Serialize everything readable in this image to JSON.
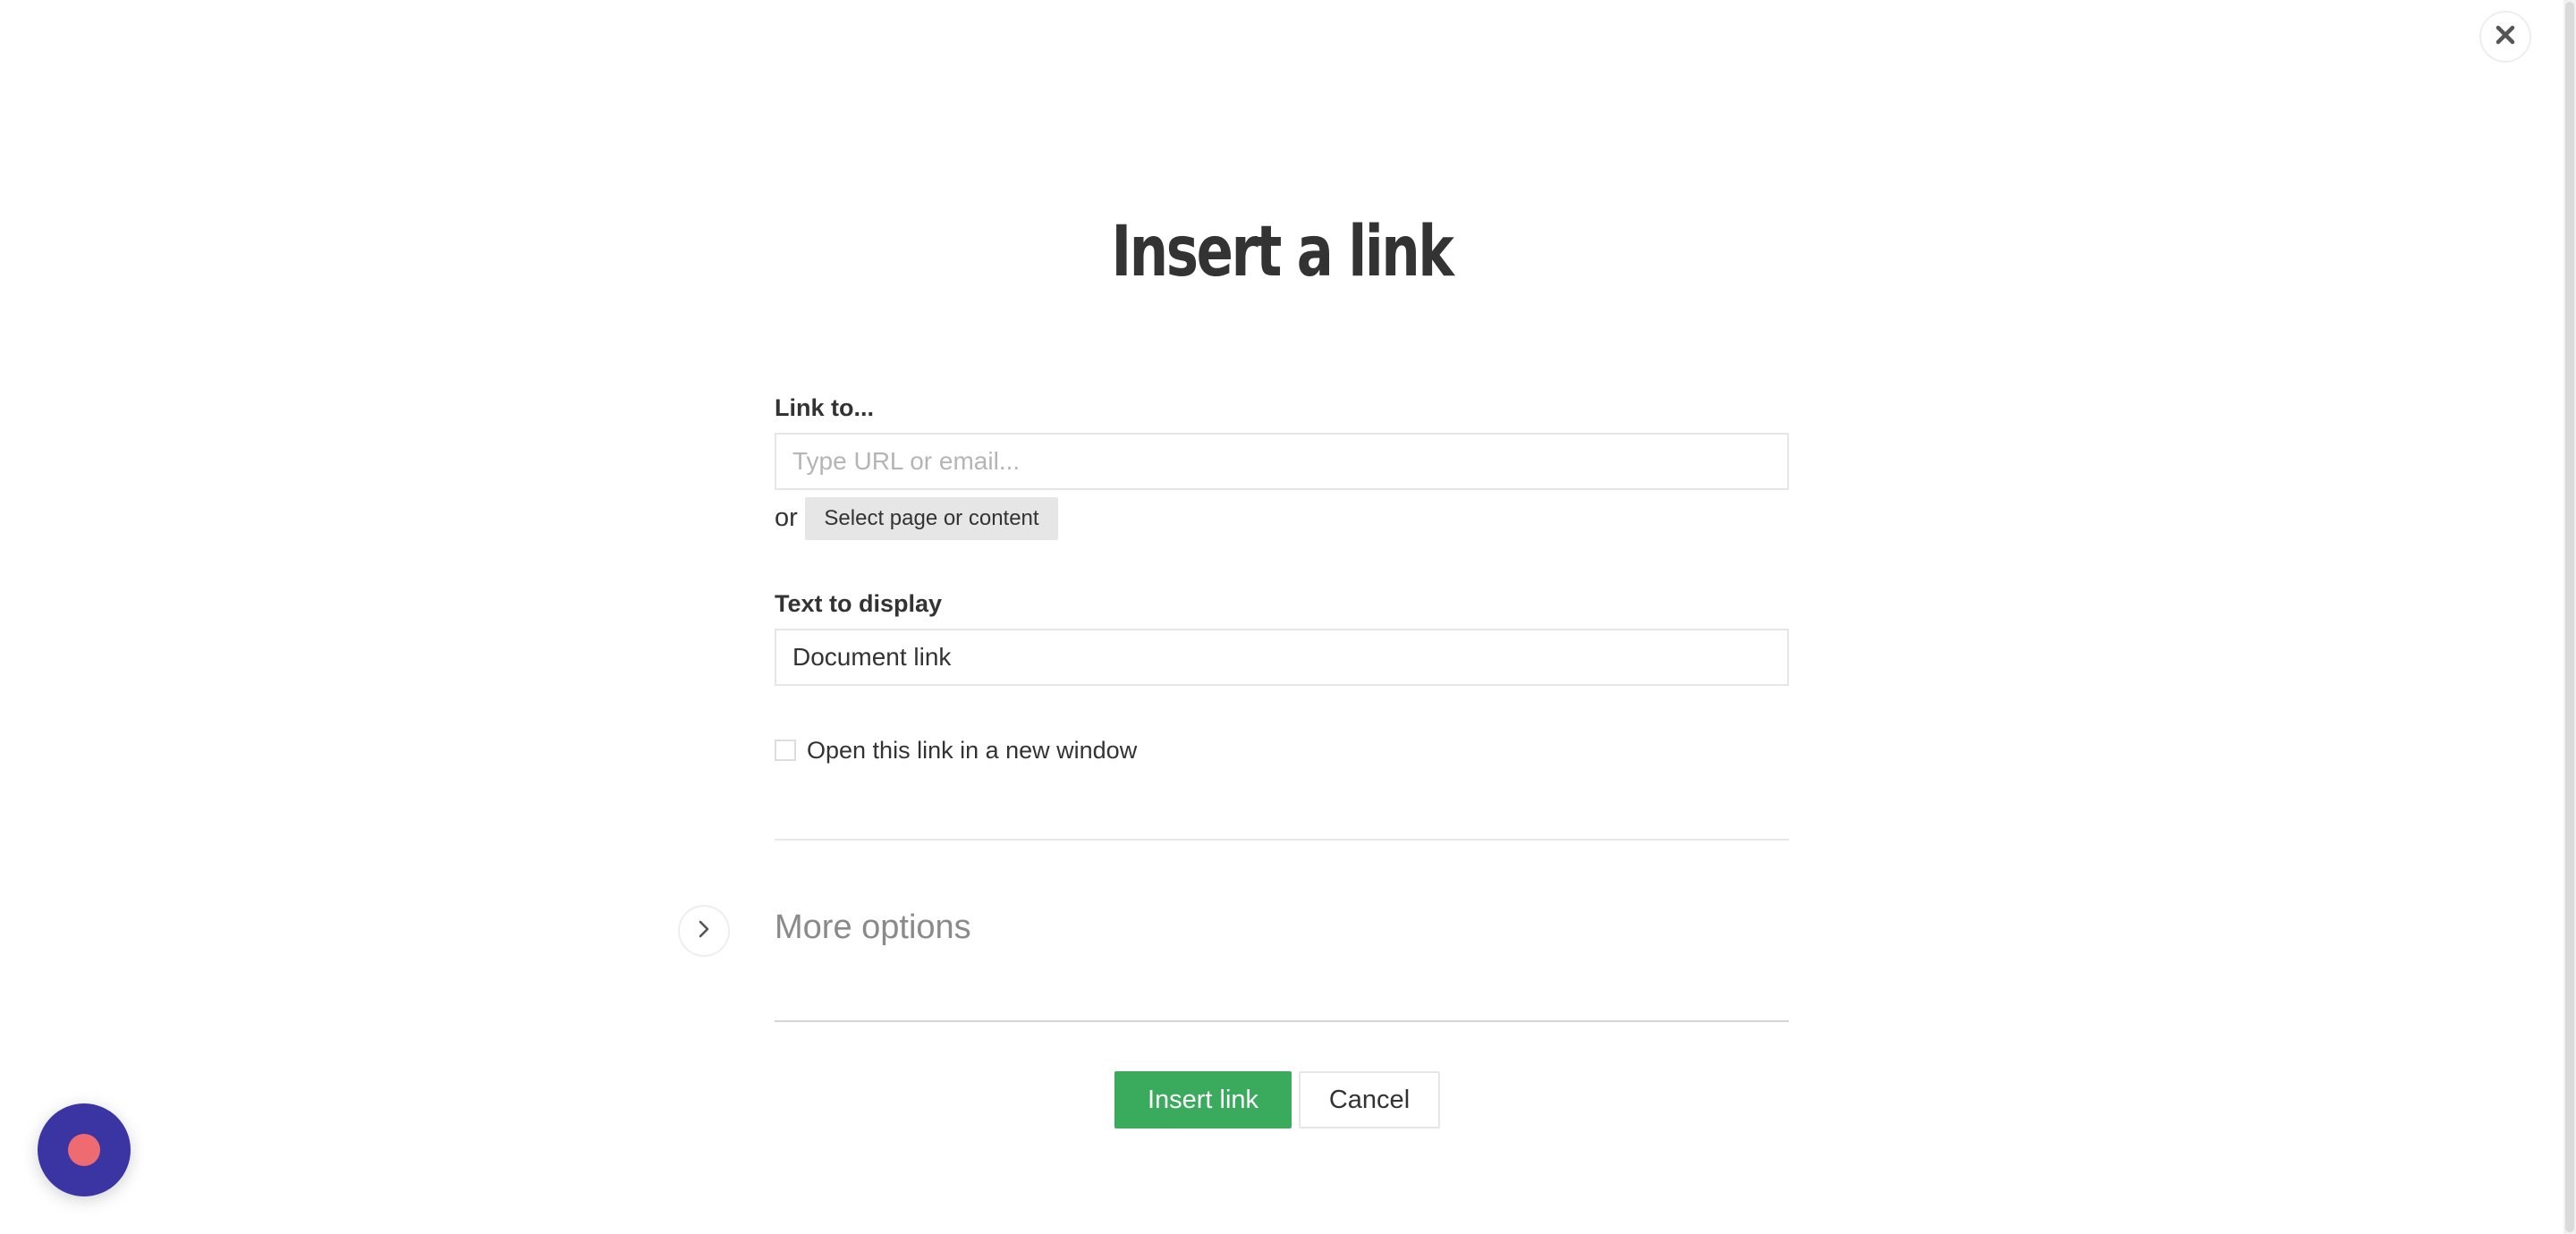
{
  "dialog": {
    "title": "Insert a link",
    "link_to": {
      "label": "Link to...",
      "placeholder": "Type URL or email...",
      "value": "",
      "or_text": "or",
      "select_button_label": "Select page or content"
    },
    "text_to_display": {
      "label": "Text to display",
      "value": "Document link"
    },
    "new_window_checkbox": {
      "label": "Open this link in a new window",
      "checked": false
    },
    "more_options": {
      "label": "More options",
      "expanded": false
    },
    "actions": {
      "insert_label": "Insert link",
      "cancel_label": "Cancel"
    }
  },
  "icons": {
    "close": "close-icon",
    "chevron": "chevron-right-icon",
    "record": "record-icon"
  },
  "colors": {
    "primary_button": "#3aaa5c",
    "record_button": "#3a35a3",
    "record_dot": "#ef6b72",
    "title_text": "#333333"
  }
}
